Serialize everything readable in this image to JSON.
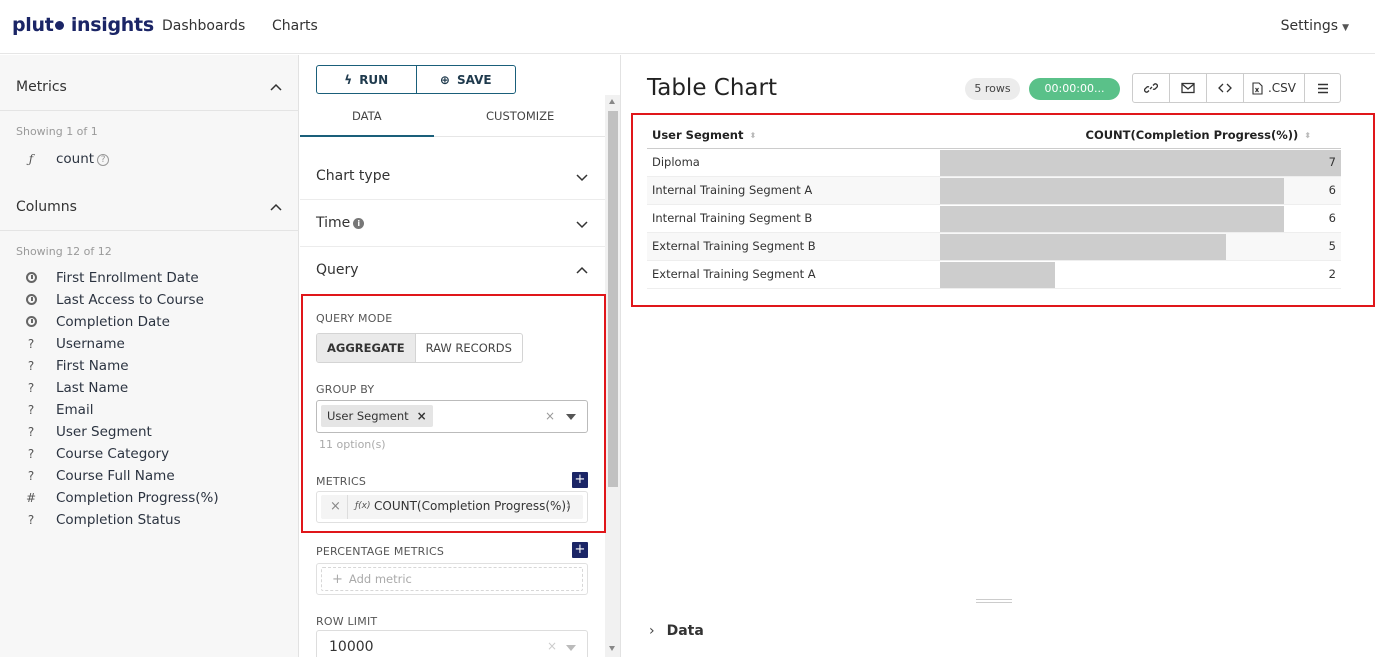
{
  "brand": {
    "name_start": "plut",
    "name_end": " insights"
  },
  "nav": {
    "dashboards": "Dashboards",
    "charts": "Charts",
    "settings": "Settings"
  },
  "sidebar": {
    "metrics_title": "Metrics",
    "metrics_showing": "Showing 1 of 1",
    "metric_icon": "ƒ",
    "metric_name": "count",
    "columns_title": "Columns",
    "columns_showing": "Showing 12 of 12",
    "columns": [
      {
        "icon": "clock",
        "name": "First Enrollment Date"
      },
      {
        "icon": "clock",
        "name": "Last Access to Course"
      },
      {
        "icon": "clock",
        "name": "Completion Date"
      },
      {
        "icon": "?",
        "name": "Username"
      },
      {
        "icon": "?",
        "name": "First Name"
      },
      {
        "icon": "?",
        "name": "Last Name"
      },
      {
        "icon": "?",
        "name": "Email"
      },
      {
        "icon": "?",
        "name": "User Segment"
      },
      {
        "icon": "?",
        "name": "Course Category"
      },
      {
        "icon": "?",
        "name": "Course Full Name"
      },
      {
        "icon": "#",
        "name": "Completion Progress(%)"
      },
      {
        "icon": "?",
        "name": "Completion Status"
      }
    ]
  },
  "controls": {
    "run_label": "RUN",
    "save_label": "SAVE",
    "tab_data": "DATA",
    "tab_customize": "CUSTOMIZE",
    "chart_type": "Chart type",
    "time": "Time",
    "query": "Query",
    "query_mode_label": "QUERY MODE",
    "mode_aggregate": "AGGREGATE",
    "mode_raw": "RAW RECORDS",
    "group_by_label": "GROUP BY",
    "group_by_value": "User Segment",
    "group_by_options": "11 option(s)",
    "metrics_label": "METRICS",
    "metric_value": "COUNT(Completion Progress(%))",
    "metric_fx": "ƒ(x)",
    "percentage_metrics_label": "PERCENTAGE METRICS",
    "add_metric_placeholder": "Add metric",
    "row_limit_label": "ROW LIMIT",
    "row_limit_value": "10000"
  },
  "chart": {
    "title": "Table Chart",
    "rows_badge": "5 rows",
    "timer": "00:00:00...",
    "csv_label": ".CSV",
    "col_segment": "User Segment",
    "col_count": "COUNT(Completion Progress(%))",
    "data_section": "Data",
    "bar_max": 7
  },
  "chart_data": {
    "type": "table",
    "columns": [
      "User Segment",
      "COUNT(Completion Progress(%))"
    ],
    "rows": [
      {
        "segment": "Diploma",
        "count": 7
      },
      {
        "segment": "Internal Training Segment A",
        "count": 6
      },
      {
        "segment": "Internal Training Segment B",
        "count": 6
      },
      {
        "segment": "External Training Segment B",
        "count": 5
      },
      {
        "segment": "External Training Segment A",
        "count": 2
      }
    ]
  },
  "colors": {
    "accent": "#1a5f7a",
    "brand": "#1b2566",
    "highlight": "#e0161a",
    "success": "#5ac189"
  }
}
